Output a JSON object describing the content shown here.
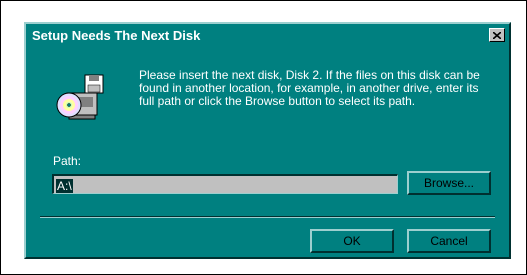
{
  "window": {
    "title": "Setup Needs The Next Disk",
    "close_glyph": "✕"
  },
  "message": "Please insert the next disk, Disk 2. If the files on this disk can be found in another location, for example, in another drive, enter its full path or click the Browse button to select its path.",
  "path": {
    "label": "Path:",
    "value": "A:\\"
  },
  "buttons": {
    "browse_label": "Browse...",
    "ok_label": "OK",
    "cancel_label": "Cancel"
  },
  "icons": {
    "setup": "setup-disk-computer-icon",
    "close": "close-icon"
  },
  "colors": {
    "dialog_bg": "#008080",
    "input_bg": "#c0c0c0",
    "selection_bg": "#003030"
  }
}
